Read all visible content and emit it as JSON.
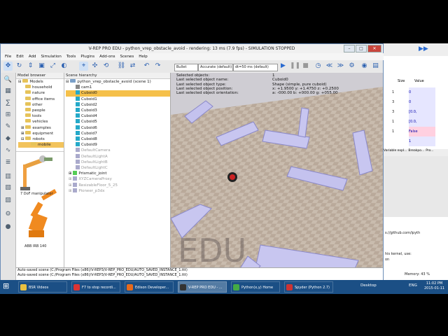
{
  "window": {
    "title": "V-REP PRO EDU - python_vrep_obstacle_avoid - rendering: 13 ms (7.9 fps) - SIMULATION STOPPED"
  },
  "menu": [
    "File",
    "Edit",
    "Add",
    "Simulation",
    "Tools",
    "Plugins",
    "Add-ons",
    "Scenes",
    "Help"
  ],
  "toolbar": {
    "engine": "Bullet",
    "accuracy": "Accurate (default)",
    "dt": "dt=50 ms (default)"
  },
  "model_browser": {
    "title": "Model browser",
    "items": [
      "Models",
      "household",
      "nature",
      "office items",
      "other",
      "people",
      "tools",
      "vehicles",
      "examples",
      "equipment",
      "robots",
      "mobile"
    ],
    "thumb1": "7 DoF manipulator",
    "thumb2": "ABB IRB 140"
  },
  "scene_hierarchy": {
    "title": "Scene hierarchy",
    "scene": "python_vrep_obstacle_avoid (scene 1)",
    "items": [
      "cam1",
      "Cuboid0",
      "Cuboid1",
      "Cuboid2",
      "Cuboid3",
      "Cuboid4",
      "Cuboid5",
      "Cuboid6",
      "Cuboid7",
      "Cuboid8",
      "Cuboid9",
      "DefaultCamera",
      "DefaultLightA",
      "DefaultLightB",
      "DefaultLightC",
      "Prismatic_joint",
      "XYZCameraProxy",
      "ResizableFloor_5_25",
      "Pioneer_p3dx"
    ]
  },
  "viewport": {
    "labels": [
      "Selected objects:",
      "Last selected object name:",
      "Last selected object type:",
      "Last selected object position:",
      "Last selected object orientation:"
    ],
    "values": [
      "1",
      "Cuboid0",
      "Shape (simple, pure cuboid)",
      "x: +1.9500   y: +1.4750   z: +0.2500",
      "a: -000.00   b: +000.00   g: +055.00"
    ],
    "watermark": "EDU"
  },
  "status": [
    "Auto-saved scene (C:/Program Files (x86)/V-REP3/V-REP_PRO_EDU/AUTO_SAVED_INSTANCE_1.ttt)",
    "Auto-saved scene (C:/Program Files (x86)/V-REP3/V-REP_PRO_EDU/AUTO_SAVED_INSTANCE_1.ttt)"
  ],
  "right_panel": {
    "col1": "Size",
    "col2": "Value",
    "rows": [
      "1",
      "0",
      "",
      "[0.0,",
      "",
      "False",
      "1"
    ],
    "tab1": "Variable expl...",
    "tab2": "Breakpo...",
    "tab3": "Pro..."
  },
  "right_console": {
    "line1": "s://github.com/ipyth",
    "line2": "his kernel, use:",
    "line3": "on"
  },
  "spyder_status": {
    "label": "Memory:",
    "value": "43 %"
  },
  "taskbar": {
    "items": [
      "BSR Videos",
      "F7 to stop recordi...",
      "Edison Developer...",
      "V-REP PRO EDU - ...",
      "Python(x,y) Home",
      "Spyder (Python 2.7)"
    ],
    "desktop": "Desktop",
    "lang": "ENG",
    "time": "11:02 PM",
    "date": "2015-01-11"
  }
}
